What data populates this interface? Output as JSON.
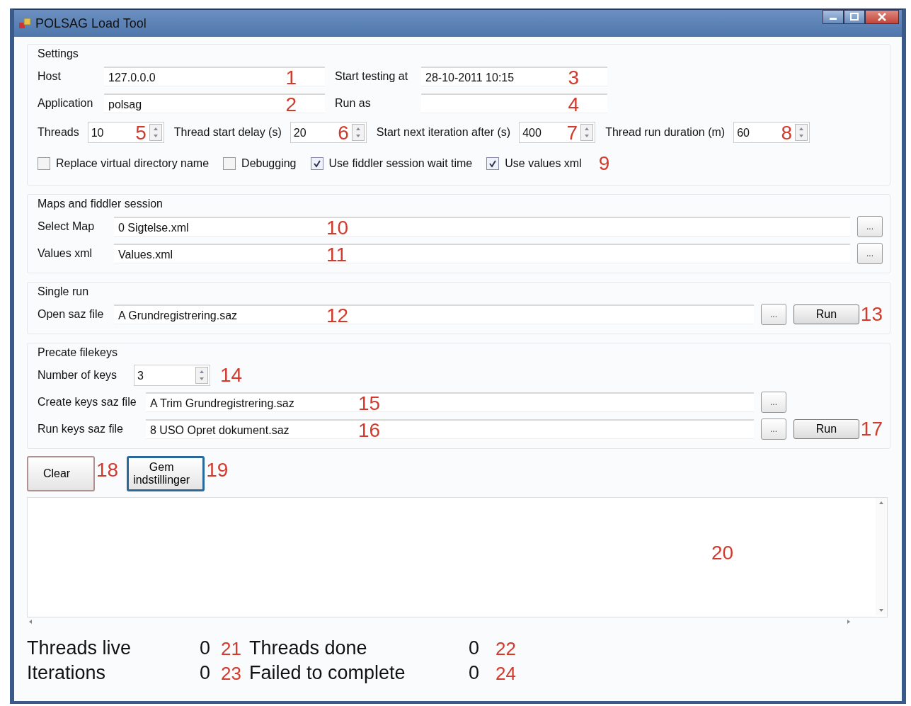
{
  "window": {
    "title": "POLSAG Load Tool"
  },
  "settings": {
    "title": "Settings",
    "fields": [
      {
        "label": "Host",
        "value": "127.0.0.0",
        "callout": "1"
      },
      {
        "label": "Start testing at",
        "value": "28-10-2011 10:15",
        "callout": "3"
      },
      {
        "label": "Application",
        "value": "polsag",
        "callout": "2"
      },
      {
        "label": "Run as",
        "callout": "4"
      }
    ],
    "spinners": [
      {
        "label": "Threads",
        "value": "10",
        "callout": "5"
      },
      {
        "label": "Thread start delay (s)",
        "value": "20",
        "callout": "6"
      },
      {
        "label": "Start next iteration after (s)",
        "value": "400",
        "callout": "7"
      },
      {
        "label": "Thread run duration (m)",
        "value": "60",
        "callout": "8"
      }
    ],
    "checkboxes": [
      {
        "label": "Replace virtual directory name",
        "checked": false
      },
      {
        "label": "Debugging",
        "checked": false
      },
      {
        "label": "Use fiddler session wait time",
        "checked": true
      },
      {
        "label": "Use values xml",
        "checked": true
      }
    ],
    "checkbox_callout": "9"
  },
  "maps": {
    "title": "Maps and fiddler session",
    "rows": [
      {
        "label": "Select Map",
        "value": "0 Sigtelse.xml",
        "callout": "10",
        "browse": "..."
      },
      {
        "label": "Values xml",
        "value": "Values.xml",
        "callout": "11",
        "browse": "..."
      }
    ]
  },
  "single_run": {
    "title": "Single run",
    "rows": [
      {
        "label": "Open saz file",
        "value": "A Grundregistrering.saz",
        "callout": "12",
        "browse": "...",
        "run": "Run",
        "run_callout": "13"
      }
    ]
  },
  "precate": {
    "title": "Precate filekeys",
    "spinner": {
      "label": "Number of keys",
      "value": "3",
      "callout": "14"
    },
    "rows": [
      {
        "label": "Create keys saz file",
        "value": "A Trim Grundregistrering.saz",
        "callout": "15",
        "browse": "..."
      },
      {
        "label": "Run keys saz file",
        "value": "8 USO Opret dokument.saz",
        "callout": "16",
        "browse": "...",
        "run": "Run",
        "run_callout": "17"
      }
    ]
  },
  "buttons": [
    {
      "label": "Clear",
      "callout": "18",
      "selected": false
    },
    {
      "label": "Gem indstillinger",
      "callout": "19",
      "selected": true
    }
  ],
  "log": {
    "callout": "20"
  },
  "stats": [
    {
      "label": "Threads live",
      "value": "0",
      "callout": "21"
    },
    {
      "label": "Threads done",
      "value": "0",
      "callout": "22"
    },
    {
      "label": "Iterations",
      "value": "0",
      "callout": "23"
    },
    {
      "label": "Failed to complete",
      "value": "0",
      "callout": "24"
    }
  ]
}
